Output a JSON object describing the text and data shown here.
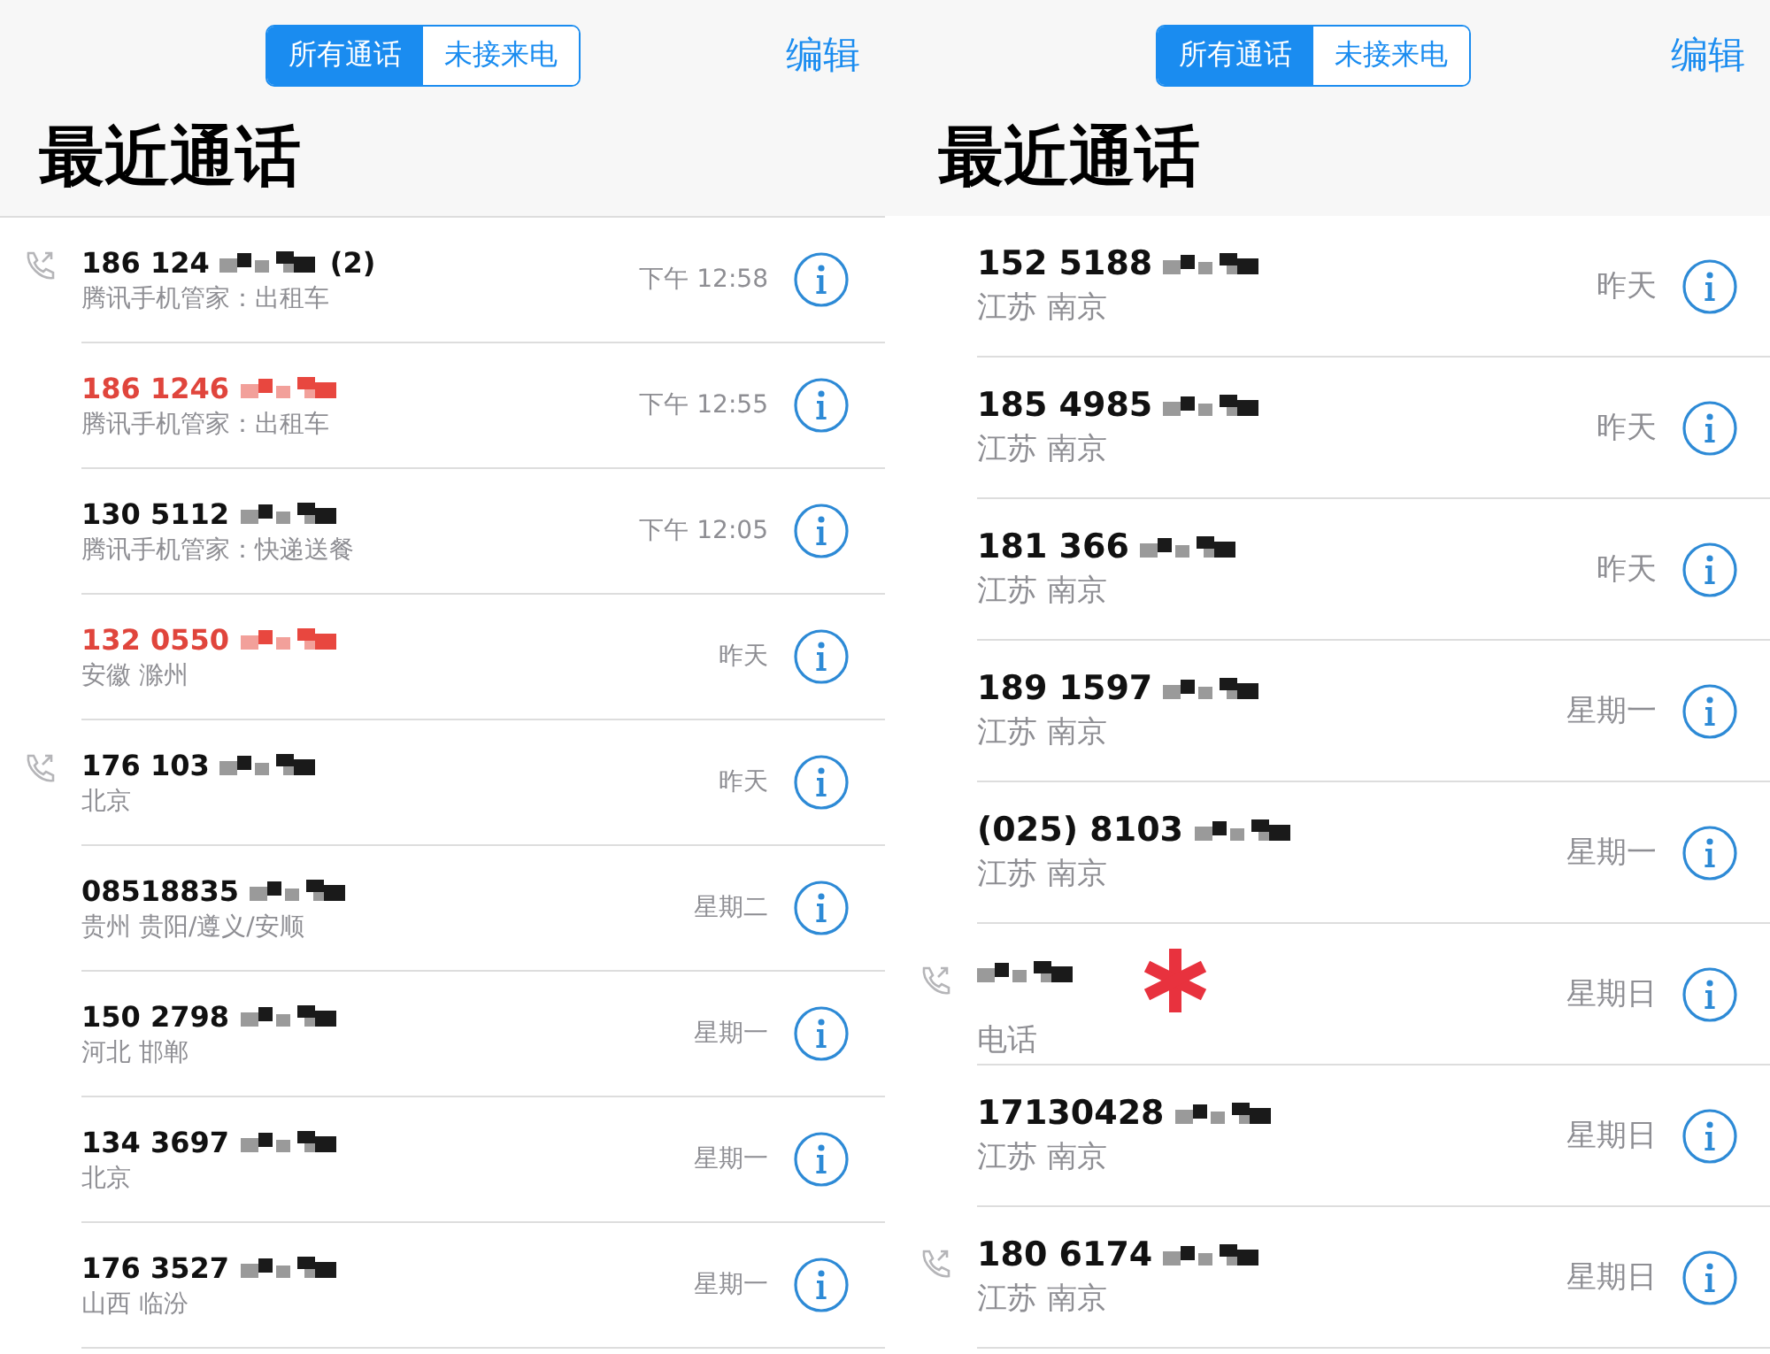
{
  "panels": [
    {
      "segments": [
        {
          "label": "所有通话",
          "selected": true
        },
        {
          "label": "未接来电",
          "selected": false
        }
      ],
      "edit": "编辑",
      "title": "最近通话",
      "calls": [
        {
          "number": "186 124",
          "count": "(2)",
          "redacted": true,
          "missed": false,
          "outgoing": true,
          "label": "腾讯手机管家：出租车",
          "time": "下午 12:58"
        },
        {
          "number": "186 1246",
          "redacted": true,
          "missed": true,
          "outgoing": false,
          "label": "腾讯手机管家：出租车",
          "time": "下午 12:55"
        },
        {
          "number": "130 5112",
          "redacted": true,
          "missed": false,
          "outgoing": false,
          "label": "腾讯手机管家：快递送餐",
          "time": "下午 12:05"
        },
        {
          "number": "132 0550",
          "redacted": true,
          "missed": true,
          "outgoing": false,
          "label": "安徽 滁州",
          "time": "昨天"
        },
        {
          "number": "176 103",
          "redacted": true,
          "missed": false,
          "outgoing": true,
          "label": "北京",
          "time": "昨天"
        },
        {
          "number": "08518835",
          "redacted": true,
          "missed": false,
          "outgoing": false,
          "label": "贵州 贵阳/遵义/安顺",
          "time": "星期二"
        },
        {
          "number": "150 2798",
          "redacted": true,
          "missed": false,
          "outgoing": false,
          "label": "河北 邯郸",
          "time": "星期一"
        },
        {
          "number": "134 3697",
          "redacted": true,
          "missed": false,
          "outgoing": false,
          "label": "北京",
          "time": "星期一"
        },
        {
          "number": "176 3527",
          "redacted": true,
          "missed": false,
          "outgoing": false,
          "label": "山西 临汾",
          "time": "星期一"
        }
      ]
    },
    {
      "segments": [
        {
          "label": "所有通话",
          "selected": true
        },
        {
          "label": "未接来电",
          "selected": false
        }
      ],
      "edit": "编辑",
      "title": "最近通话",
      "calls": [
        {
          "number": "152 5188",
          "redacted": true,
          "missed": false,
          "outgoing": false,
          "label": "江苏 南京",
          "time": "昨天"
        },
        {
          "number": "185 4985",
          "redacted": true,
          "missed": false,
          "outgoing": false,
          "label": "江苏 南京",
          "time": "昨天"
        },
        {
          "number": "181 366",
          "redacted": true,
          "missed": false,
          "outgoing": false,
          "label": "江苏 南京",
          "time": "昨天"
        },
        {
          "number": "189 1597",
          "redacted": true,
          "missed": false,
          "outgoing": false,
          "label": "江苏 南京",
          "time": "星期一"
        },
        {
          "number": "(025) 8103",
          "redacted": true,
          "missed": false,
          "outgoing": false,
          "label": "江苏 南京",
          "time": "星期一"
        },
        {
          "redacted": true,
          "marked": true,
          "missed": false,
          "outgoing": true,
          "label": "电话",
          "time": "星期日"
        },
        {
          "number": "17130428",
          "redacted": true,
          "missed": false,
          "outgoing": false,
          "label": "江苏 南京",
          "time": "星期日"
        },
        {
          "number": "180 6174",
          "redacted": true,
          "missed": false,
          "outgoing": true,
          "label": "江苏 南京",
          "time": "星期日"
        }
      ]
    }
  ]
}
